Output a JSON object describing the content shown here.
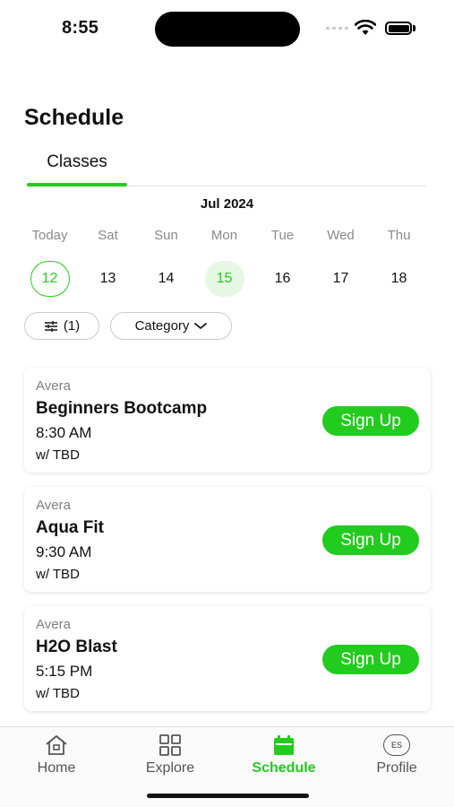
{
  "status": {
    "time": "8:55"
  },
  "page_title": "Schedule",
  "tabs": [
    {
      "label": "Classes"
    }
  ],
  "calendar": {
    "month": "Jul 2024",
    "weekdays": [
      "Today",
      "Sat",
      "Sun",
      "Mon",
      "Tue",
      "Wed",
      "Thu"
    ],
    "dates": [
      "12",
      "13",
      "14",
      "15",
      "16",
      "17",
      "18"
    ]
  },
  "filters": {
    "count": "(1)",
    "category": "Category"
  },
  "classes": [
    {
      "location": "Avera",
      "name": "Beginners Bootcamp",
      "time": "8:30 AM",
      "instructor": "w/ TBD",
      "action": "Sign Up"
    },
    {
      "location": "Avera",
      "name": "Aqua Fit",
      "time": "9:30 AM",
      "instructor": "w/ TBD",
      "action": "Sign Up"
    },
    {
      "location": "Avera",
      "name": "H2O Blast",
      "time": "5:15 PM",
      "instructor": "w/ TBD",
      "action": "Sign Up"
    }
  ],
  "nav": {
    "items": [
      {
        "label": "Home",
        "icon": "home-icon"
      },
      {
        "label": "Explore",
        "icon": "grid-icon"
      },
      {
        "label": "Schedule",
        "icon": "calendar-icon"
      },
      {
        "label": "Profile",
        "icon": "avatar"
      }
    ],
    "avatar_initials": "ES"
  },
  "colors": {
    "accent": "#22cc1e",
    "selected_bg": "#e6f7e3"
  }
}
